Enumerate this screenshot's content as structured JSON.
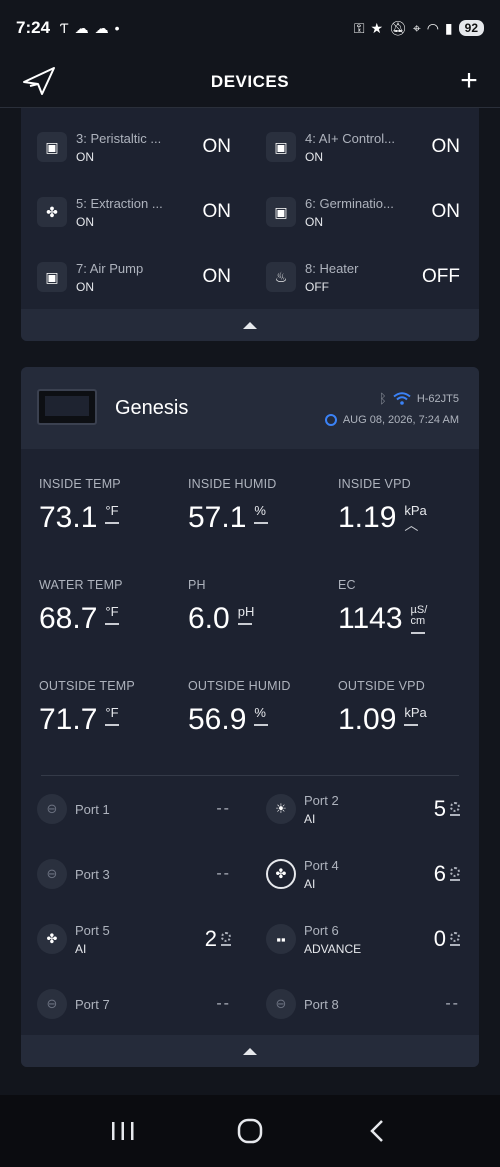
{
  "status_bar": {
    "time": "7:24",
    "battery": "92",
    "left_icons": [
      "t-mobile-icon",
      "cloud-icon",
      "cloud-icon",
      "dot-icon"
    ],
    "right_icons": [
      "key-icon",
      "star-icon",
      "mute-icon",
      "location-icon",
      "wifi-icon",
      "signal-icon"
    ]
  },
  "header": {
    "title": "DEVICES"
  },
  "outlets": [
    {
      "name": "3: Peristaltic ...",
      "state": "ON",
      "value": "ON",
      "icon": "outlet-icon"
    },
    {
      "name": "4: AI+ Control...",
      "state": "ON",
      "value": "ON",
      "icon": "outlet-icon"
    },
    {
      "name": "5: Extraction ...",
      "state": "ON",
      "value": "ON",
      "icon": "fan-icon"
    },
    {
      "name": "6: Germinatio...",
      "state": "ON",
      "value": "ON",
      "icon": "outlet-icon"
    },
    {
      "name": "7: Air Pump",
      "state": "ON",
      "value": "ON",
      "icon": "outlet-icon"
    },
    {
      "name": "8: Heater",
      "state": "OFF",
      "value": "OFF",
      "icon": "flame-icon"
    }
  ],
  "device": {
    "name": "Genesis",
    "id": "H-62JT5",
    "datetime": "AUG 08, 2026, 7:24 AM"
  },
  "metrics": [
    {
      "label": "INSIDE TEMP",
      "value": "73.1",
      "unit": "°F",
      "trend": "dash"
    },
    {
      "label": "INSIDE HUMID",
      "value": "57.1",
      "unit": "%",
      "trend": "dash"
    },
    {
      "label": "INSIDE VPD",
      "value": "1.19",
      "unit": "kPa",
      "trend": "up"
    },
    {
      "label": "WATER TEMP",
      "value": "68.7",
      "unit": "°F",
      "trend": "dash"
    },
    {
      "label": "PH",
      "value": "6.0",
      "unit": "pH",
      "trend": "dash"
    },
    {
      "label": "EC",
      "value": "1143",
      "unit": "µS/ cm",
      "trend": "dash"
    },
    {
      "label": "OUTSIDE TEMP",
      "value": "71.7",
      "unit": "°F",
      "trend": "dash"
    },
    {
      "label": "OUTSIDE HUMID",
      "value": "56.9",
      "unit": "%",
      "trend": "dash"
    },
    {
      "label": "OUTSIDE VPD",
      "value": "1.09",
      "unit": "kPa",
      "trend": "dash"
    }
  ],
  "ports": [
    {
      "name": "Port 1",
      "mode": "",
      "value": "--",
      "icon": "link-icon"
    },
    {
      "name": "Port 2",
      "mode": "AI",
      "value": "5",
      "icon": "sunrise-icon"
    },
    {
      "name": "Port 3",
      "mode": "",
      "value": "--",
      "icon": "link-icon"
    },
    {
      "name": "Port 4",
      "mode": "AI",
      "value": "6",
      "icon": "fan-icon"
    },
    {
      "name": "Port 5",
      "mode": "AI",
      "value": "2",
      "icon": "fan-icon"
    },
    {
      "name": "Port 6",
      "mode": "ADVANCE",
      "value": "0",
      "icon": "humidifier-icon"
    },
    {
      "name": "Port 7",
      "mode": "",
      "value": "--",
      "icon": "link-icon"
    },
    {
      "name": "Port 8",
      "mode": "",
      "value": "--",
      "icon": "link-icon"
    }
  ]
}
